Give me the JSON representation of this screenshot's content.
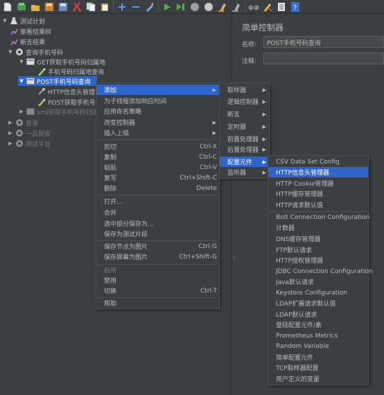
{
  "toolbar": {
    "icons": [
      "new-icon",
      "templates-icon",
      "open-icon",
      "save-icon",
      "save-as-icon",
      "cut-icon",
      "copy-icon",
      "paste-icon",
      "expand-icon",
      "collapse-icon",
      "toggle-icon",
      "start-icon",
      "start-no-pause-icon",
      "stop-icon",
      "shutdown-icon",
      "clear-icon",
      "clear-all-icon",
      "search-icon",
      "reset-search-icon",
      "function-helper-icon",
      "help-icon"
    ]
  },
  "tree": {
    "test_plan": "测试计划",
    "view_results_tree": "察看结果树",
    "assertion_results": "断言结果",
    "query_phone": "查询手机号码",
    "get_phone_location": "GET获取手机号码归属地",
    "phone_location_query": "手机号码归属地查询",
    "post_phone_query": "POST手机号码查询",
    "http_header_manager": "HTTP信息头管理",
    "post_get_phone": "POST获取手机号",
    "xml_get_phone": "xml获取手机号码归属",
    "login": "登录",
    "customer": "一品顾客",
    "test_platform": "测试平台"
  },
  "panel": {
    "title": "简单控制器",
    "name_label": "名称:",
    "name_value": "POST手机号码查询",
    "comment_label": "注释:"
  },
  "context_menu": {
    "add": "添加",
    "add_think_times": "为子线程添加响应时间",
    "apply_naming": "应用命名策略",
    "change_controller": "改变控制器",
    "insert_parent": "插入上级",
    "cut": "剪切",
    "cut_key": "Ctrl-X",
    "copy": "复制",
    "copy_key": "Ctrl-C",
    "paste": "粘贴",
    "paste_key": "Ctrl-V",
    "duplicate": "复写",
    "duplicate_key": "Ctrl+Shift-C",
    "remove": "删除",
    "remove_key": "Delete",
    "open": "打开...",
    "merge": "合并",
    "save_selection": "选中部分保存为...",
    "save_as_fragment": "保存为测试片段",
    "save_node_image": "保存节点为图片",
    "save_node_key": "Ctrl-G",
    "save_screen_image": "保存屏幕为图片",
    "save_screen_key": "Ctrl+Shift-G",
    "enable": "启用",
    "disable": "禁用",
    "toggle": "切换",
    "toggle_key": "Ctrl-T",
    "help": "帮助"
  },
  "add_menu": {
    "sampler": "取样器",
    "logic_controller": "逻辑控制器",
    "assertion": "断言",
    "timer": "定时器",
    "pre_processor": "前置处理器",
    "post_processor": "后置处理器",
    "config_element": "配置元件",
    "listener": "监听器"
  },
  "config_menu": {
    "items": [
      "CSV Data Set Config",
      "HTTP信息头管理器",
      "HTTP Cookie管理器",
      "HTTP缓存管理器",
      "HTTP请求默认值",
      "Bolt Connection Configuration",
      "计数器",
      "DNS缓存管理器",
      "FTP默认请求",
      "HTTP授权管理器",
      "JDBC Connection Configuration",
      "Java默认请求",
      "Keystore Configuration",
      "LDAP扩展请求默认值",
      "LDAP默认请求",
      "登陆配置元件/素",
      "Prometheus Metrics",
      "Random Variable",
      "简单配置元件",
      "TCP取样器配置",
      "用户定义的变量"
    ]
  },
  "colors": {
    "background": "#3c3f41",
    "selection": "#2f65ca",
    "text": "#bbbbbb",
    "disabled_text": "#777777"
  }
}
